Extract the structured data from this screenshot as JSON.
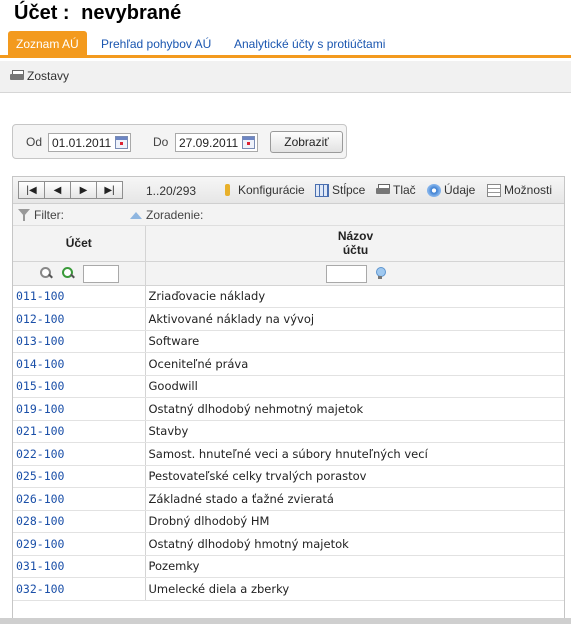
{
  "header": {
    "title_label": "Účet :",
    "title_value": "nevybrané"
  },
  "tabs": [
    {
      "label": "Zoznam AÚ",
      "active": true
    },
    {
      "label": "Prehľad pohybov AÚ",
      "active": false
    },
    {
      "label": "Analytické účty s protiúčtami",
      "active": false
    }
  ],
  "toolbar": {
    "reports_label": "Zostavy"
  },
  "date_filter": {
    "from_label": "Od",
    "from_value": "01.01.2011",
    "to_label": "Do",
    "to_value": "27.09.2011",
    "show_button": "Zobraziť"
  },
  "pager": {
    "first_icon": "first-page-icon",
    "prev_icon": "prev-page-icon",
    "next_icon": "next-page-icon",
    "last_icon": "last-page-icon",
    "range": "1..20/293",
    "actions": [
      "Konfigurácie",
      "Stĺpce",
      "Tlač",
      "Údaje",
      "Možnosti"
    ]
  },
  "filter_bar": {
    "filter_label": "Filter:",
    "sort_label": "Zoradenie:"
  },
  "table": {
    "col_account": "Účet",
    "col_name": "Názov\núčtu",
    "rows": [
      {
        "code": "011-100",
        "name": "Zriaďovacie náklady"
      },
      {
        "code": "012-100",
        "name": "Aktivované náklady na vývoj"
      },
      {
        "code": "013-100",
        "name": "Software"
      },
      {
        "code": "014-100",
        "name": "Oceniteľné práva"
      },
      {
        "code": "015-100",
        "name": "Goodwill"
      },
      {
        "code": "019-100",
        "name": "Ostatný dlhodobý nehmotný majetok"
      },
      {
        "code": "021-100",
        "name": "Stavby"
      },
      {
        "code": "022-100",
        "name": "Samost. hnuteľné veci a súbory hnuteľných vecí"
      },
      {
        "code": "025-100",
        "name": "Pestovateľské celky trvalých porastov"
      },
      {
        "code": "026-100",
        "name": "Základné stado a ťažné zvieratá"
      },
      {
        "code": "028-100",
        "name": "Drobný dlhodobý HM"
      },
      {
        "code": "029-100",
        "name": "Ostatný dlhodobý hmotný majetok"
      },
      {
        "code": "031-100",
        "name": "Pozemky"
      },
      {
        "code": "032-100",
        "name": "Umelecké diela a zberky"
      }
    ]
  },
  "colors": {
    "accent": "#f39a1e",
    "link": "#1a4fa8"
  }
}
